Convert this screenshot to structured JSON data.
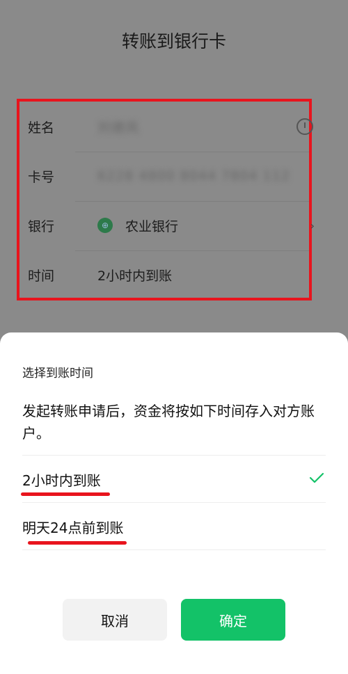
{
  "header": {
    "title": "转账到银行卡"
  },
  "form": {
    "rows": [
      {
        "label": "姓名",
        "value": "刘德凤"
      },
      {
        "label": "卡号",
        "value": "6228 4800 8044 7804 112"
      },
      {
        "label": "银行",
        "value": "农业银行"
      },
      {
        "label": "时间",
        "value": "2小时内到账"
      }
    ]
  },
  "sheet": {
    "title": "选择到账时间",
    "description": "发起转账申请后，资金将按如下时间存入对方账户。",
    "options": [
      {
        "label": "2小时内到账",
        "selected": true
      },
      {
        "label": "明天24点前到账",
        "selected": false
      }
    ],
    "cancel_label": "取消",
    "confirm_label": "确定"
  },
  "colors": {
    "accent": "#13c268",
    "highlight": "#e8141d"
  }
}
